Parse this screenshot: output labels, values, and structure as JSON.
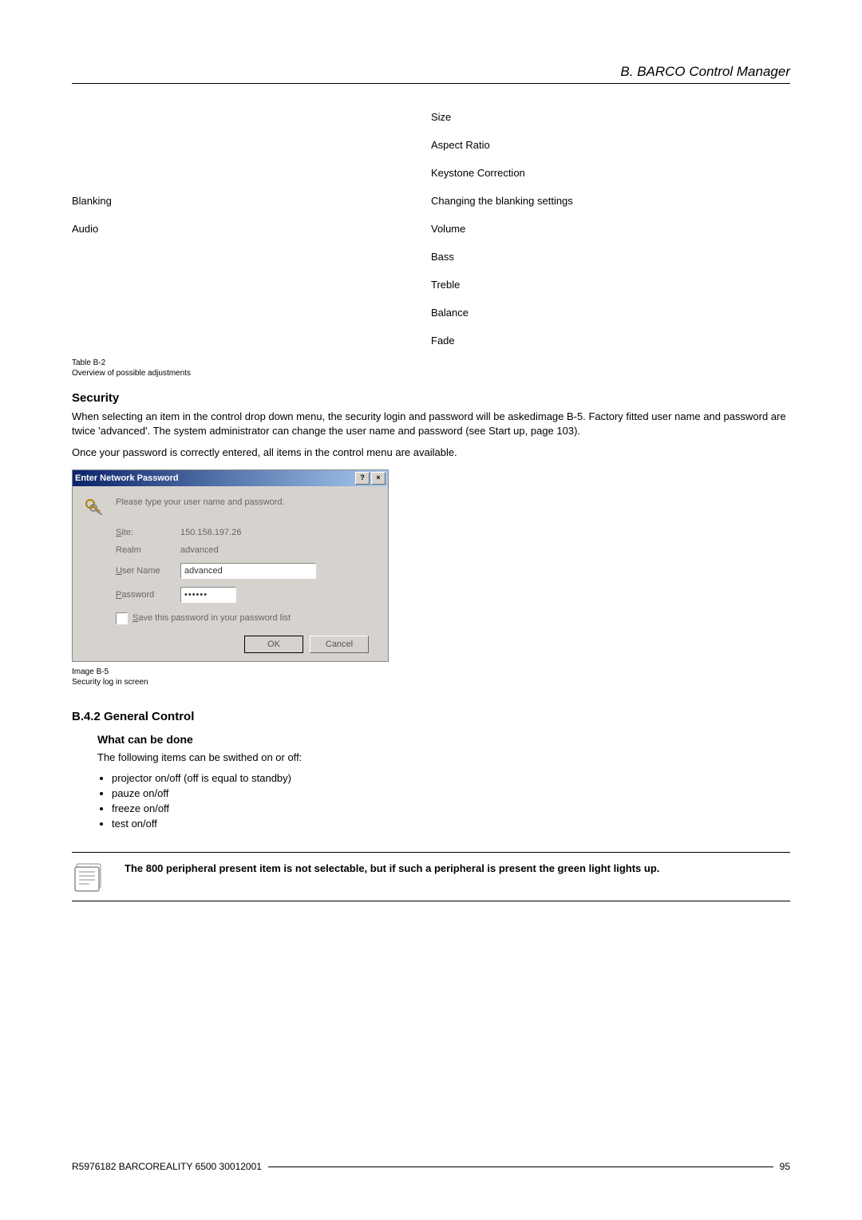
{
  "header": {
    "title": "B. BARCO Control Manager"
  },
  "adj_table": {
    "rows": [
      {
        "c1": "",
        "c2": "Size"
      },
      {
        "c1": "",
        "c2": "Aspect Ratio"
      },
      {
        "c1": "",
        "c2": "Keystone Correction"
      },
      {
        "c1": "Blanking",
        "c2": "Changing the blanking settings"
      },
      {
        "c1": "Audio",
        "c2": "Volume"
      },
      {
        "c1": "",
        "c2": "Bass"
      },
      {
        "c1": "",
        "c2": "Treble"
      },
      {
        "c1": "",
        "c2": "Balance"
      },
      {
        "c1": "",
        "c2": "Fade"
      }
    ],
    "caption_line1": "Table B-2",
    "caption_line2": "Overview of possible adjustments"
  },
  "security": {
    "heading": "Security",
    "para1": "When selecting an item in the control drop down menu, the security login and password will be askedimage B-5. Factory fitted user name and password are twice 'advanced'. The system administrator can change the user name and password (see Start up, page 103).",
    "para2": "Once your password is correctly entered, all items in the control menu are available."
  },
  "dialog": {
    "title": "Enter Network Password",
    "help_btn": "?",
    "close_btn": "×",
    "prompt": "Please type your user name and password.",
    "site_label": "Site:",
    "site_value": "150.158.197.26",
    "realm_label": "Realm",
    "realm_value": "advanced",
    "user_label": "User Name",
    "user_value": "advanced",
    "password_label": "Password",
    "password_value": "••••••",
    "save_label": "Save this password in your password list",
    "ok": "OK",
    "cancel": "Cancel"
  },
  "img_caption": {
    "line1": "Image B-5",
    "line2": "Security log in screen"
  },
  "general": {
    "heading": "B.4.2 General Control",
    "sub_heading": "What can be done",
    "intro": "The following items can be swithed on or off:",
    "items": [
      "projector on/off (off is equal to standby)",
      "pauze on/off",
      "freeze on/off",
      "test on/off"
    ]
  },
  "note": {
    "text": "The 800 peripheral present item is not selectable, but if such a peripheral is present the green light lights up."
  },
  "footer": {
    "left": "R5976182  BARCOREALITY 6500  30012001",
    "page": "95"
  }
}
